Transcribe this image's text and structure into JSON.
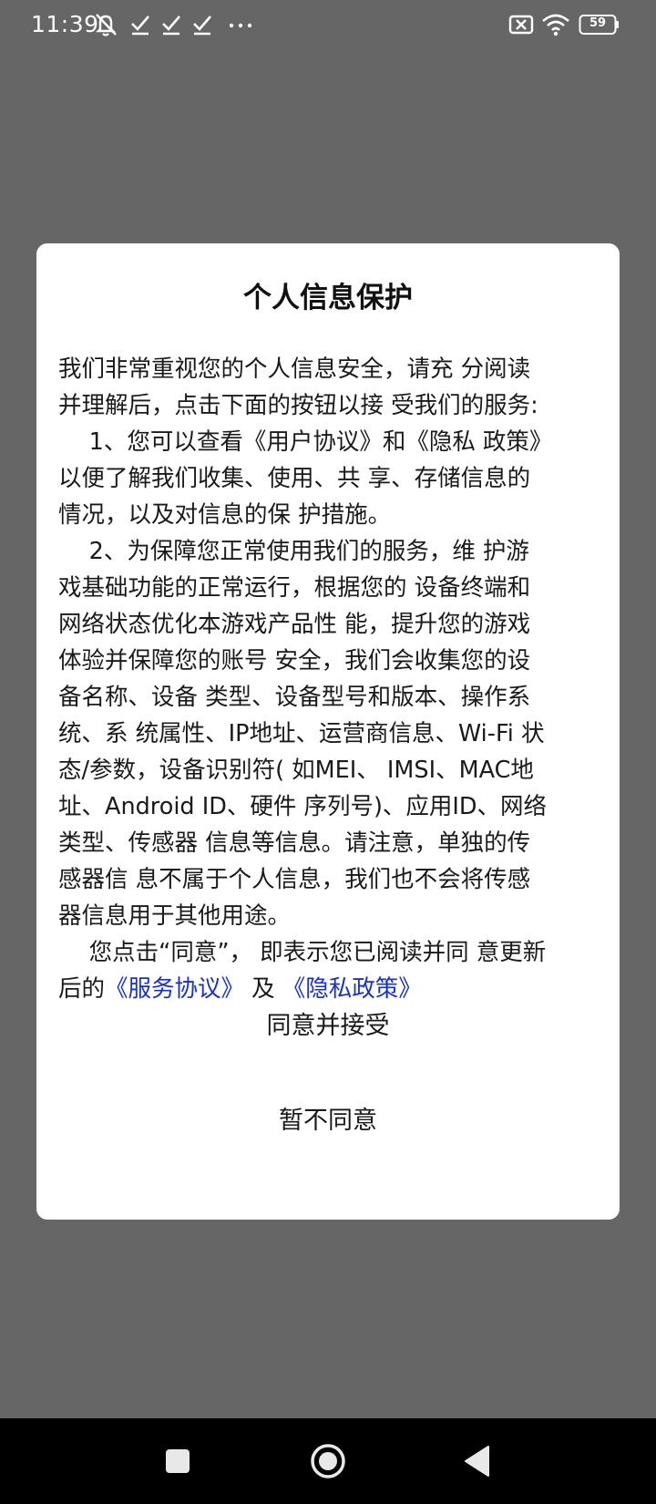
{
  "status_bar": {
    "time": "11:39",
    "battery": "59",
    "icons": [
      "notifications-muted-icon",
      "check-icon",
      "check-icon",
      "check-icon",
      "more-dots-icon",
      "no-sim-icon",
      "wifi-icon",
      "battery-icon"
    ]
  },
  "dialog": {
    "title": "个人信息保护",
    "paragraphs": [
      "我们非常重视您的个人信息安全，请充 分阅读",
      "并理解后，点击下面的按钮以接 受我们的服务:",
      "　 1、您可以查看《用户协议》和《隐私 政策》",
      "以便了解我们收集、使用、共 享、存储信息的",
      "情况，以及对信息的保 护措施。",
      "　 2、为保障您正常使用我们的服务，维 护游",
      "戏基础功能的正常运行，根据您的 设备终端和",
      "网络状态优化本游戏产品性 能，提升您的游戏",
      "体验并保障您的账号 安全，我们会收集您的设",
      "备名称、设备 类型、设备型号和版本、操作系",
      "统、系 统属性、IP地址、运营商信息、Wi-Fi 状",
      "态/参数，设备识别符( 如MEI、 IMSI、MAC地",
      "址、Android ID、硬件 序列号)、应用ID、网络",
      "类型、传感器 信息等信息。请注意，单独的传",
      "感器信 息不属于个人信息，我们也不会将传感",
      "器信息用于其他用途。",
      "　 您点击“同意”， 即表示您已阅读并同 意更新"
    ],
    "last_line_prefix": "后的",
    "service_link": "《服务协议》",
    "and_text": "及",
    "privacy_link": "《隐私政策》",
    "agree_label": "同意并接受",
    "decline_label": "暂不同意",
    "link_color": "#1a2fcc"
  },
  "nav_bar": {
    "buttons": [
      "recent-apps-icon",
      "home-icon",
      "back-icon"
    ]
  }
}
